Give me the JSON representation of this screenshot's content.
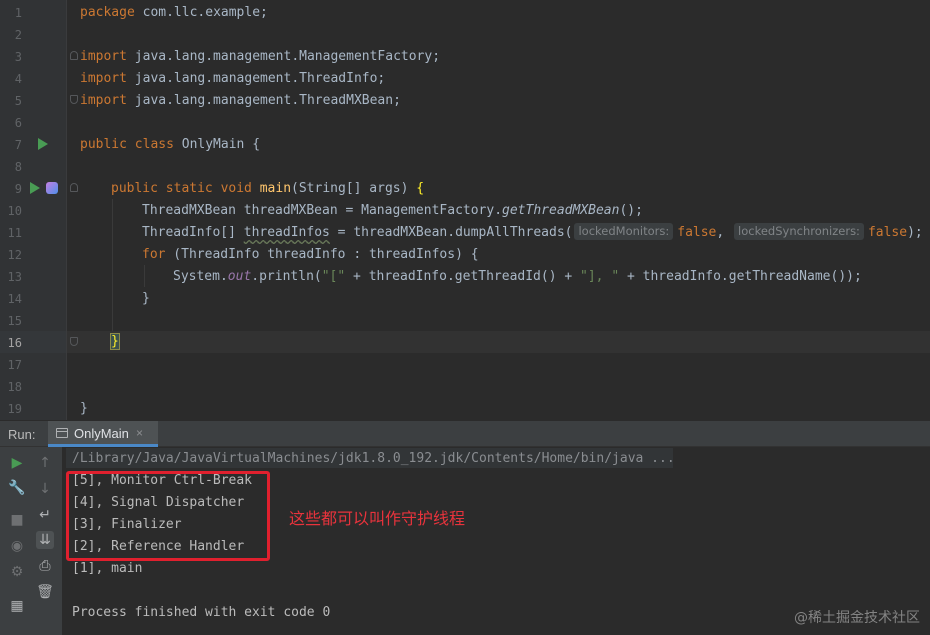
{
  "editor": {
    "line_numbers": [
      "1",
      "2",
      "3",
      "4",
      "5",
      "6",
      "7",
      "8",
      "9",
      "10",
      "11",
      "12",
      "13",
      "14",
      "15",
      "16",
      "17",
      "18",
      "19"
    ],
    "current_line": "16",
    "code": {
      "l1": [
        "package",
        " com.llc.example;"
      ],
      "l3": [
        "import",
        " java.lang.management.ManagementFactory;"
      ],
      "l4": [
        "import",
        " java.lang.management.ThreadInfo;"
      ],
      "l5": [
        "import",
        " java.lang.management.ThreadMXBean;"
      ],
      "l7": [
        "public class",
        " OnlyMain {"
      ],
      "l9": [
        "public static void",
        " ",
        "main",
        "(String[] args) ",
        "{"
      ],
      "l10": [
        "ThreadMXBean threadMXBean = ManagementFactory.",
        "getThreadMXBean",
        "();"
      ],
      "l11": [
        "ThreadInfo[] ",
        "threadInfos",
        " = threadMXBean.dumpAllThreads(",
        "lockedMonitors:",
        "false",
        ", ",
        "lockedSynchronizers:",
        "false",
        ");"
      ],
      "l12": [
        "for",
        " (ThreadInfo threadInfo : threadInfos) {"
      ],
      "l13": [
        "System.",
        "out",
        ".println(",
        "\"[\"",
        " + threadInfo.getThreadId() + ",
        "\"], \"",
        " + threadInfo.getThreadName());"
      ],
      "l14": [
        "}"
      ],
      "l16": [
        "}"
      ],
      "l19": [
        "}"
      ]
    }
  },
  "run_window": {
    "label": "Run:",
    "tab_title": "OnlyMain",
    "tab_close": "×",
    "console": [
      "/Library/Java/JavaVirtualMachines/jdk1.8.0_192.jdk/Contents/Home/bin/java ...",
      "[5], Monitor Ctrl-Break",
      "[4], Signal Dispatcher",
      "[3], Finalizer",
      "[2], Reference Handler",
      "[1], main",
      "",
      "Process finished with exit code 0"
    ]
  },
  "annotation": "这些都可以叫作守护线程",
  "watermark": "@稀土掘金技术社区",
  "icons": {
    "run": "run-icon",
    "bean": "spring-bean-icon",
    "rerun": "rerun-icon",
    "wrench": "settings-icon",
    "stop": "stop-icon",
    "camera": "dump-threads-icon",
    "gear": "gear-icon",
    "layout": "layout-icon",
    "up": "arrow-up-icon",
    "down": "arrow-down-icon",
    "wrap": "soft-wrap-icon",
    "scroll": "scroll-to-end-icon",
    "print": "print-icon",
    "trash": "trash-icon"
  },
  "colors": {
    "annotation": "#e8333c",
    "highlight_box": "#e0202e",
    "keyword": "#cc7832",
    "string": "#6a8759",
    "method_decl": "#ffc66d",
    "static_field": "#9876aa"
  }
}
